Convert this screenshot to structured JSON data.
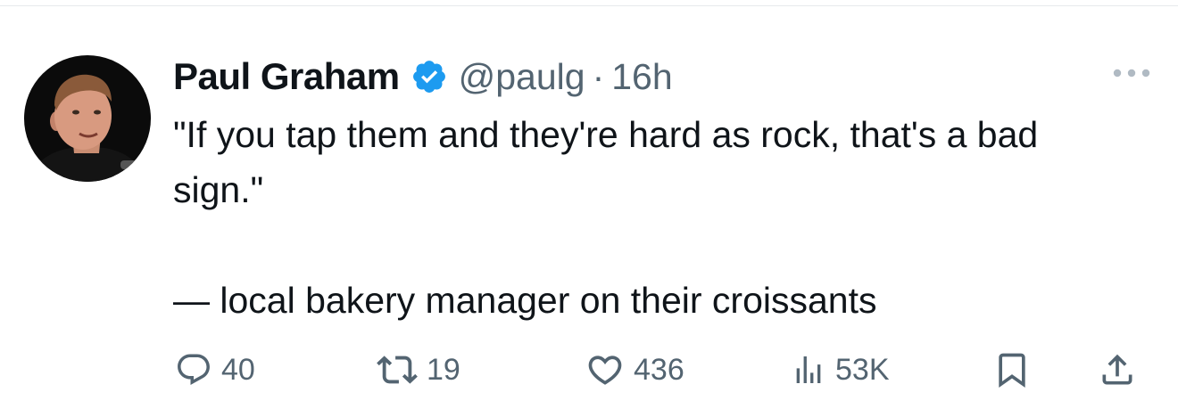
{
  "author": {
    "display_name": "Paul Graham",
    "handle": "@paulg",
    "separator": "·",
    "time": "16h",
    "verified": true
  },
  "tweet": {
    "paragraphs": [
      "\"If you tap them and they're hard as rock, that's a bad sign.\"",
      "— local bakery manager on their croissants"
    ]
  },
  "actions": {
    "replies": "40",
    "retweets": "19",
    "likes": "436",
    "views": "53K"
  },
  "colors": {
    "text": "#0f1419",
    "secondary": "#536471",
    "verified": "#1d9bf0",
    "divider": "#e6e9ec"
  },
  "icons": {
    "verified": "verified-badge-icon",
    "more": "more-icon",
    "reply": "reply-icon",
    "retweet": "retweet-icon",
    "like": "heart-icon",
    "views": "views-icon",
    "bookmark": "bookmark-icon",
    "share": "share-icon"
  }
}
